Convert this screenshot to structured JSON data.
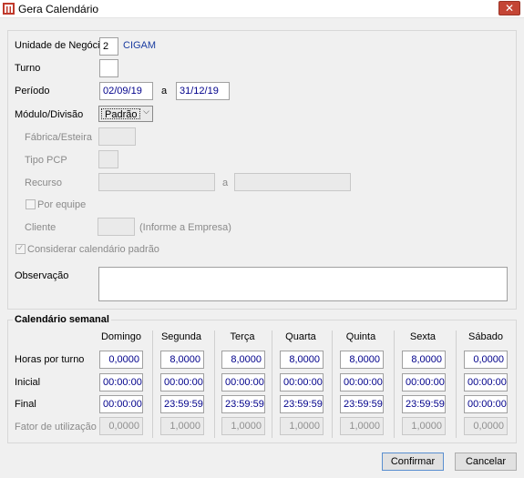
{
  "window": {
    "title": "Gera Calendário",
    "close_symbol": "✕",
    "app_icon": "grid-app-icon"
  },
  "form": {
    "unidade_label": "Unidade de Negócio",
    "unidade_value": "2",
    "unidade_name": "CIGAM",
    "turno_label": "Turno",
    "turno_value": "",
    "periodo_label": "Período",
    "periodo_start": "02/09/19",
    "periodo_sep": "a",
    "periodo_end": "31/12/19",
    "modulo_label": "Módulo/Divisão",
    "modulo_value": "Padrão",
    "fabrica_label": "Fábrica/Esteira",
    "tipo_pcp_label": "Tipo PCP",
    "recurso_label": "Recurso",
    "recurso_sep": "a",
    "por_equipe_label": "Por equipe",
    "cliente_label": "Cliente",
    "cliente_hint": "(Informe a Empresa)",
    "considerar_label": "Considerar calendário padrão",
    "considerar_checked": true,
    "observacao_label": "Observação",
    "observacao_value": ""
  },
  "weekly": {
    "title": "Calendário semanal",
    "days": [
      "Domingo",
      "Segunda",
      "Terça",
      "Quarta",
      "Quinta",
      "Sexta",
      "Sábado"
    ],
    "rows": [
      {
        "label": "Horas por turno",
        "values": [
          "0,0000",
          "8,0000",
          "8,0000",
          "8,0000",
          "8,0000",
          "8,0000",
          "0,0000"
        ],
        "disabled": false
      },
      {
        "label": "Inicial",
        "values": [
          "00:00:00",
          "00:00:00",
          "00:00:00",
          "00:00:00",
          "00:00:00",
          "00:00:00",
          "00:00:00"
        ],
        "disabled": false
      },
      {
        "label": "Final",
        "values": [
          "00:00:00",
          "23:59:59",
          "23:59:59",
          "23:59:59",
          "23:59:59",
          "23:59:59",
          "00:00:00"
        ],
        "disabled": false
      },
      {
        "label": "Fator de utilização",
        "values": [
          "0,0000",
          "1,0000",
          "1,0000",
          "1,0000",
          "1,0000",
          "1,0000",
          "0,0000"
        ],
        "disabled": true
      }
    ]
  },
  "buttons": {
    "confirm": "Confirmar",
    "cancel": "Cancelar"
  }
}
